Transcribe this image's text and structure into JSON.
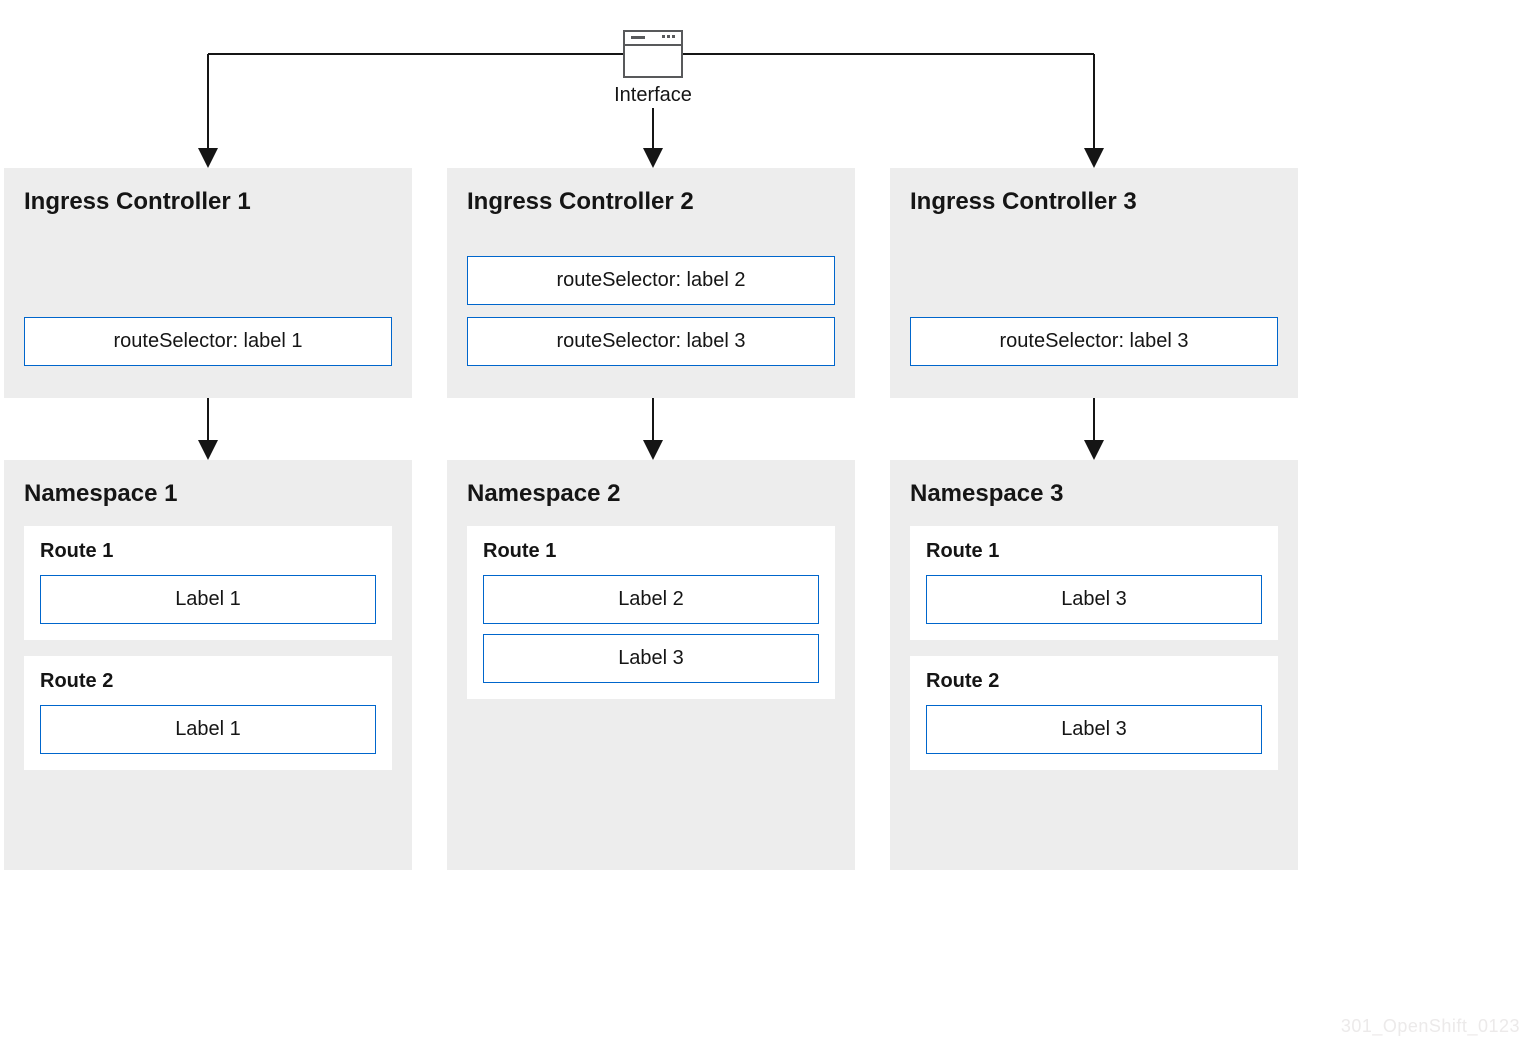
{
  "interface_label": "Interface",
  "controllers": [
    {
      "title": "Ingress Controller 1",
      "selectors": [
        "routeSelector: label 1"
      ]
    },
    {
      "title": "Ingress Controller 2",
      "selectors": [
        "routeSelector: label 2",
        "routeSelector: label 3"
      ]
    },
    {
      "title": "Ingress Controller 3",
      "selectors": [
        "routeSelector: label 3"
      ]
    }
  ],
  "namespaces": [
    {
      "title": "Namespace 1",
      "routes": [
        {
          "title": "Route 1",
          "labels": [
            "Label 1"
          ]
        },
        {
          "title": "Route 2",
          "labels": [
            "Label 1"
          ]
        }
      ]
    },
    {
      "title": "Namespace 2",
      "routes": [
        {
          "title": "Route 1",
          "labels": [
            "Label 2",
            "Label 3"
          ]
        }
      ]
    },
    {
      "title": "Namespace 3",
      "routes": [
        {
          "title": "Route 1",
          "labels": [
            "Label 3"
          ]
        },
        {
          "title": "Route 2",
          "labels": [
            "Label 3"
          ]
        }
      ]
    }
  ],
  "watermark": "301_OpenShift_0123"
}
